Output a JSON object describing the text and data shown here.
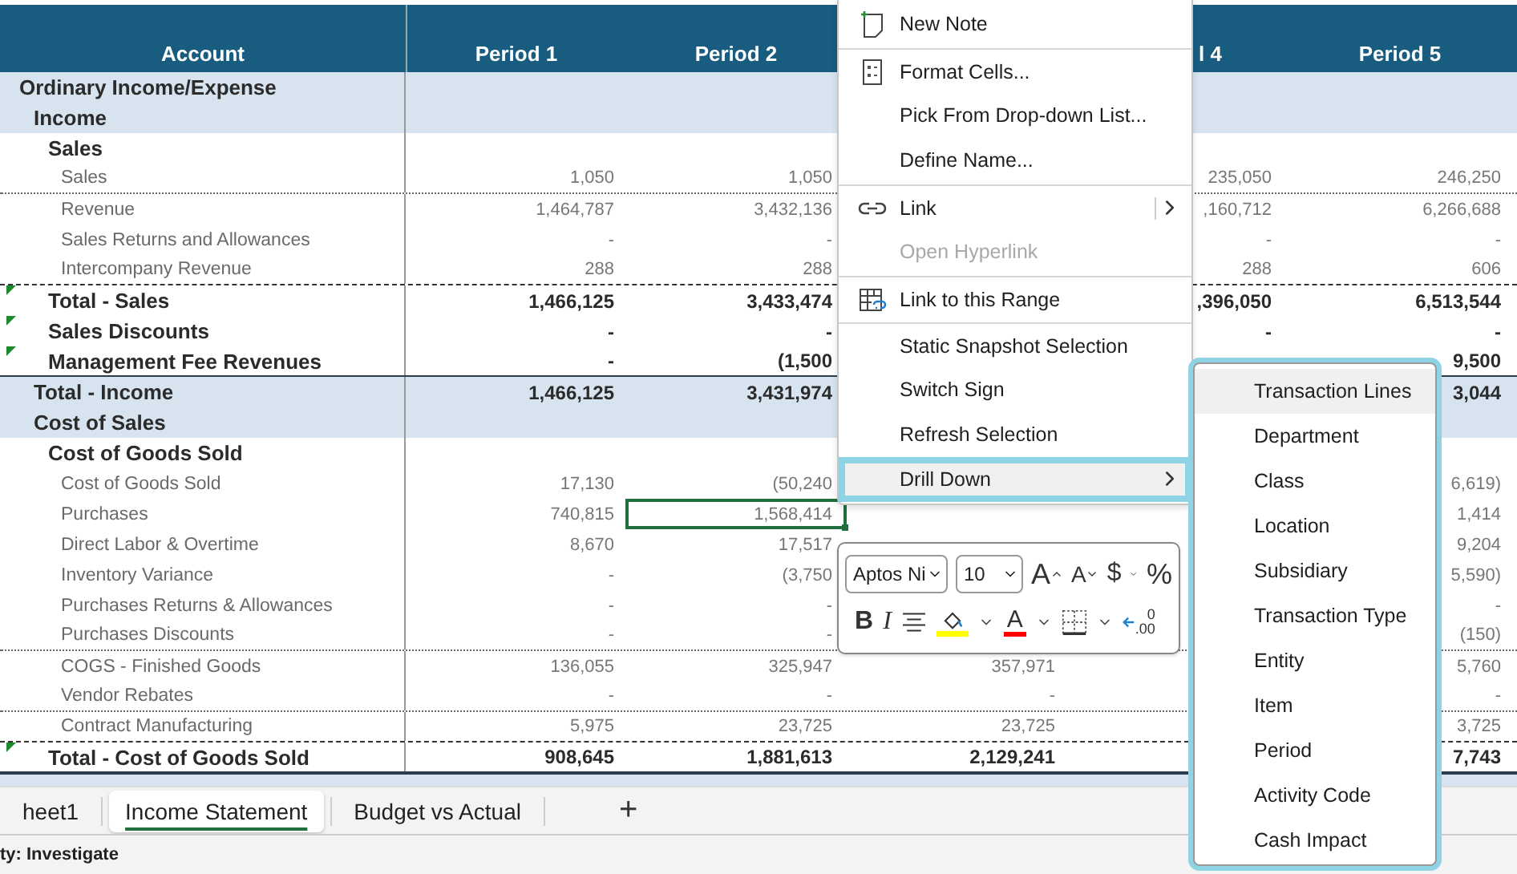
{
  "table": {
    "columns": {
      "account": "Account",
      "period_1": "Period 1",
      "period_2": "Period 2",
      "period_4": "l 4",
      "period_5": "Period 5"
    },
    "rows": [
      {
        "label": "Ordinary Income/Expense",
        "kind": "section",
        "children": [
          {
            "label": "Income",
            "kind": "section",
            "children": [
              {
                "label": "Sales",
                "kind": "group",
                "children": [
                  {
                    "label": "Sales",
                    "kind": "detail",
                    "dotted_rule": true,
                    "values": {
                      "period_1": "1,050",
                      "period_2": "1,050",
                      "period_4": "235,050",
                      "period_5": "246,250"
                    }
                  },
                  {
                    "label": "Revenue",
                    "kind": "detail",
                    "values": {
                      "period_1": "1,464,787",
                      "period_2": "3,432,136",
                      "period_4": ",160,712",
                      "period_5": "6,266,688"
                    }
                  },
                  {
                    "label": "Sales Returns and Allowances",
                    "kind": "detail",
                    "values": {
                      "period_1": "-",
                      "period_2": "-",
                      "period_4": "-",
                      "period_5": "-"
                    }
                  },
                  {
                    "label": "Intercompany Revenue",
                    "kind": "detail",
                    "dashed_rule": true,
                    "values": {
                      "period_1": "288",
                      "period_2": "288",
                      "period_4": "288",
                      "period_5": "606"
                    }
                  }
                ]
              },
              {
                "label": "Total - Sales",
                "kind": "total",
                "values": {
                  "period_1": "1,466,125",
                  "period_2": "3,433,474",
                  "period_4": ",396,050",
                  "period_5": "6,513,544"
                }
              },
              {
                "label": "Sales Discounts",
                "kind": "total",
                "values": {
                  "period_1": "-",
                  "period_2": "-",
                  "period_4": "-",
                  "period_5": "-"
                }
              },
              {
                "label": "Management Fee Revenues",
                "kind": "total",
                "solid_rule": true,
                "values": {
                  "period_1": "-",
                  "period_2": "(1,500",
                  "period_5": "9,500"
                }
              }
            ]
          },
          {
            "label": "Total - Income",
            "kind": "section",
            "values": {
              "period_1": "1,466,125",
              "period_2": "3,431,974",
              "period_5": "3,044"
            }
          },
          {
            "label": "Cost of Sales",
            "kind": "section",
            "children": [
              {
                "label": "Cost of Goods Sold",
                "kind": "group",
                "children": [
                  {
                    "label": "Cost of Goods Sold",
                    "kind": "detail",
                    "values": {
                      "period_1": "17,130",
                      "period_2": "(50,240",
                      "period_5": "6,619)"
                    }
                  },
                  {
                    "label": "Purchases",
                    "kind": "detail",
                    "values": {
                      "period_1": "740,815",
                      "period_2": {
                        "text": "1,568,414",
                        "selected": true
                      },
                      "period_5": "1,414"
                    }
                  },
                  {
                    "label": "Direct Labor & Overtime",
                    "kind": "detail",
                    "values": {
                      "period_1": "8,670",
                      "period_2": "17,517",
                      "period_5": "9,204"
                    }
                  },
                  {
                    "label": "Inventory Variance",
                    "kind": "detail",
                    "values": {
                      "period_1": "-",
                      "period_2": "(3,750",
                      "period_5": "5,590)"
                    }
                  },
                  {
                    "label": "Purchases Returns & Allowances",
                    "kind": "detail",
                    "values": {
                      "period_1": "-",
                      "period_2": "-",
                      "period_5": "-"
                    }
                  },
                  {
                    "label": "Purchases Discounts",
                    "kind": "detail",
                    "dotted_rule": true,
                    "values": {
                      "period_1": "-",
                      "period_2": "-",
                      "period_5": "(150)"
                    }
                  },
                  {
                    "label": "COGS - Finished Goods",
                    "kind": "detail",
                    "values": {
                      "period_1": "136,055",
                      "period_2": "325,947",
                      "period_3": "357,971",
                      "period_5": "5,760"
                    }
                  },
                  {
                    "label": "Vendor Rebates",
                    "kind": "detail",
                    "dotted_rule": true,
                    "values": {
                      "period_1": "-",
                      "period_2": "-",
                      "period_3": "-",
                      "period_5": "-"
                    }
                  },
                  {
                    "label": "Contract Manufacturing",
                    "kind": "detail",
                    "dashed_rule": true,
                    "values": {
                      "period_1": "5,975",
                      "period_2": "23,725",
                      "period_3": "23,725",
                      "period_5": "3,725"
                    }
                  }
                ]
              },
              {
                "label": "Total - Cost of Goods Sold",
                "kind": "total",
                "solid_rule": true,
                "values": {
                  "period_1": "908,645",
                  "period_2": "1,881,613",
                  "period_3": "2,129,241",
                  "period_5": "7,743"
                }
              }
            ]
          }
        ]
      }
    ]
  },
  "context_menu": [
    {
      "label": "New Note",
      "kind": "note",
      "separator_before": false,
      "disabled": false,
      "submenu": false,
      "selected": false
    },
    {
      "label": "Format Cells...",
      "kind": "format",
      "separator_before": true,
      "disabled": false,
      "submenu": false,
      "selected": false
    },
    {
      "label": "Pick From Drop-down List...",
      "kind": "plain",
      "separator_before": false,
      "disabled": false,
      "submenu": false,
      "selected": false
    },
    {
      "label": "Define Name...",
      "kind": "plain",
      "separator_before": false,
      "disabled": false,
      "submenu": false,
      "selected": false
    },
    {
      "label": "Link",
      "kind": "link",
      "separator_before": true,
      "disabled": false,
      "submenu": true,
      "selected": false
    },
    {
      "label": "Open Hyperlink",
      "kind": "plain",
      "separator_before": false,
      "disabled": true,
      "submenu": false,
      "selected": false
    },
    {
      "label": "Link to this Range",
      "kind": "range",
      "separator_before": true,
      "disabled": false,
      "submenu": false,
      "selected": false
    },
    {
      "label": "Static Snapshot Selection",
      "kind": "plain",
      "separator_before": true,
      "disabled": false,
      "submenu": false,
      "selected": false
    },
    {
      "label": "Switch Sign",
      "kind": "plain",
      "separator_before": false,
      "disabled": false,
      "submenu": false,
      "selected": false
    },
    {
      "label": "Refresh Selection",
      "kind": "plain",
      "separator_before": false,
      "disabled": false,
      "submenu": false,
      "selected": false
    },
    {
      "label": "Drill Down",
      "kind": "plain",
      "separator_before": false,
      "disabled": false,
      "submenu": true,
      "selected": true
    }
  ],
  "mini_toolbar": {
    "font": "Aptos Ni",
    "size": "10",
    "row_1": [
      {
        "kind": "grow",
        "text": "A"
      },
      {
        "kind": "shrink",
        "text": "A"
      },
      {
        "kind": "currency",
        "text": "$"
      },
      {
        "kind": "dropdown"
      },
      {
        "kind": "percent",
        "text": "%"
      }
    ],
    "row_2": [
      {
        "kind": "bold",
        "text": "B"
      },
      {
        "kind": "italic",
        "text": "I"
      },
      {
        "kind": "align"
      },
      {
        "kind": "fill",
        "color": "#ffff00"
      },
      {
        "kind": "dropdown"
      },
      {
        "kind": "font_color",
        "text": "A",
        "color": "#ff0000"
      },
      {
        "kind": "dropdown"
      },
      {
        "kind": "borders"
      },
      {
        "kind": "dropdown"
      },
      {
        "kind": "decimal",
        "lines": [
          "0",
          ".00"
        ]
      }
    ]
  },
  "drill_down_menu": [
    {
      "label": "Transaction Lines",
      "selected": true
    },
    {
      "label": "Department",
      "selected": false
    },
    {
      "label": "Class",
      "selected": false
    },
    {
      "label": "Location",
      "selected": false
    },
    {
      "label": "Subsidiary",
      "selected": false
    },
    {
      "label": "Transaction Type",
      "selected": false
    },
    {
      "label": "Entity",
      "selected": false
    },
    {
      "label": "Item",
      "selected": false
    },
    {
      "label": "Period",
      "selected": false
    },
    {
      "label": "Activity Code",
      "selected": false
    },
    {
      "label": "Cash Impact",
      "selected": false
    }
  ],
  "sheet_tabs": [
    {
      "label": "heet1",
      "selected": false
    },
    {
      "label": "Income Statement",
      "selected": true
    },
    {
      "label": "Budget vs Actual",
      "selected": false
    }
  ],
  "add_sheet": "+",
  "status_bar": "ty: Investigate"
}
